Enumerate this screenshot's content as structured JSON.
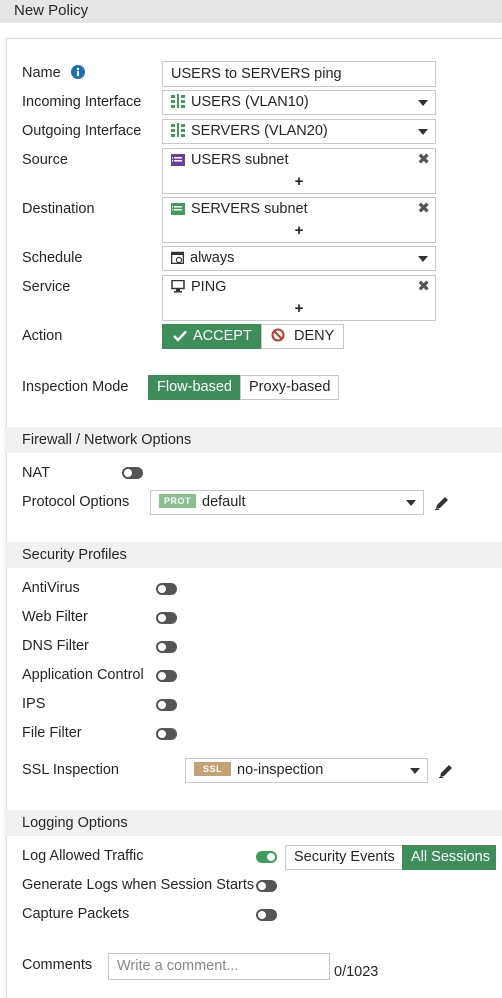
{
  "header": {
    "title": "New Policy"
  },
  "form": {
    "name": {
      "label": "Name",
      "value": "USERS to SERVERS ping"
    },
    "incoming": {
      "label": "Incoming Interface",
      "value": "USERS (VLAN10)"
    },
    "outgoing": {
      "label": "Outgoing Interface",
      "value": "SERVERS (VLAN20)"
    },
    "source": {
      "label": "Source",
      "value": "USERS subnet"
    },
    "destination": {
      "label": "Destination",
      "value": "SERVERS subnet"
    },
    "schedule": {
      "label": "Schedule",
      "value": "always"
    },
    "service": {
      "label": "Service",
      "value": "PING"
    },
    "action": {
      "label": "Action",
      "accept": "ACCEPT",
      "deny": "DENY",
      "selected": "ACCEPT"
    },
    "inspection": {
      "label": "Inspection Mode",
      "flow": "Flow-based",
      "proxy": "Proxy-based",
      "selected": "Flow-based"
    }
  },
  "firewall": {
    "title": "Firewall / Network Options",
    "nat": {
      "label": "NAT",
      "enabled": false
    },
    "protocol": {
      "label": "Protocol Options",
      "badge": "PROT",
      "value": "default",
      "badge_color": "#8bbf8f"
    }
  },
  "security": {
    "title": "Security Profiles",
    "items": [
      {
        "label": "AntiVirus",
        "enabled": false
      },
      {
        "label": "Web Filter",
        "enabled": false
      },
      {
        "label": "DNS Filter",
        "enabled": false
      },
      {
        "label": "Application Control",
        "enabled": false
      },
      {
        "label": "IPS",
        "enabled": false
      },
      {
        "label": "File Filter",
        "enabled": false
      }
    ],
    "ssl": {
      "label": "SSL Inspection",
      "badge": "SSL",
      "value": "no-inspection",
      "badge_color": "#c4a277"
    }
  },
  "logging": {
    "title": "Logging Options",
    "allowed": {
      "label": "Log Allowed Traffic",
      "enabled": true,
      "security_events": "Security Events",
      "all_sessions": "All Sessions",
      "selected": "All Sessions"
    },
    "session_start": {
      "label": "Generate Logs when Session Starts",
      "enabled": false
    },
    "capture": {
      "label": "Capture Packets",
      "enabled": false
    }
  },
  "comments": {
    "label": "Comments",
    "placeholder": "Write a comment...",
    "counter": "0/1023"
  },
  "colors": {
    "accent": "#3e8e5a",
    "info": "#1f6fb5",
    "interface_icon": "#3e9e5a",
    "address_icon": "#6b3fa0"
  }
}
